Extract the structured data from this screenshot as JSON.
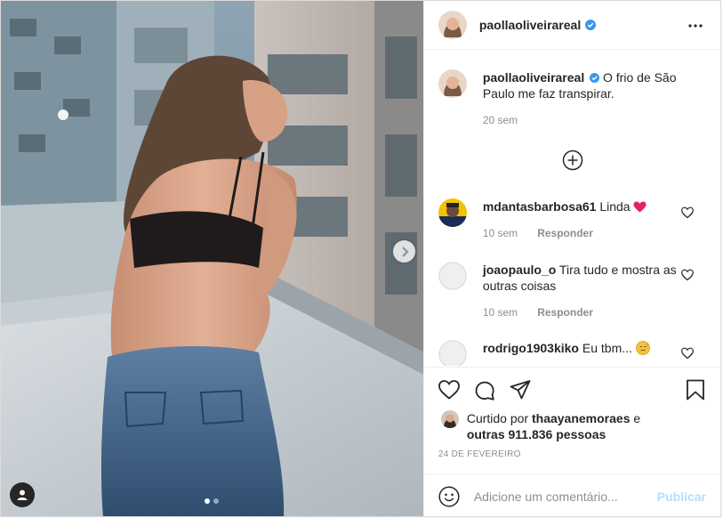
{
  "post": {
    "author": "paollaoliveirareal",
    "verified": true,
    "caption_user": "paollaoliveirareal",
    "caption_text": "O frio de São Paulo me faz transpirar.",
    "caption_time": "20 sem",
    "carousel": {
      "slides": 2,
      "current": 1
    }
  },
  "comments": [
    {
      "user": "mdantasbarbosa61",
      "text": "Linda",
      "emoji": "heart",
      "time": "10 sem",
      "reply_label": "Responder"
    },
    {
      "user": "joaopaulo_o",
      "text": "Tira tudo e mostra as outras coisas",
      "time": "10 sem",
      "reply_label": "Responder"
    },
    {
      "user": "rodrigo1903kiko",
      "text": "Eu tbm...",
      "emoji": "sweat-face"
    }
  ],
  "likes": {
    "prefix": "Curtido por",
    "user": "thaayanemoraes",
    "connector": "e",
    "others": "outras 911.836 pessoas"
  },
  "date": "24 DE FEVEREIRO",
  "add_comment": {
    "placeholder": "Adicione um comentário...",
    "publish_label": "Publicar"
  },
  "icons": {
    "more": "more-horizontal-icon",
    "like": "heart-icon",
    "comment": "comment-icon",
    "share": "share-icon",
    "save": "bookmark-icon",
    "emoji": "emoji-icon",
    "load_more": "plus-circle-icon",
    "next": "chevron-right-icon",
    "tags": "user-tag-icon"
  },
  "colors": {
    "verified": "#3897f0",
    "text": "#262626",
    "muted": "#8e8e8e",
    "publish_disabled": "#b2dffc",
    "heart_red": "#ed4956"
  }
}
